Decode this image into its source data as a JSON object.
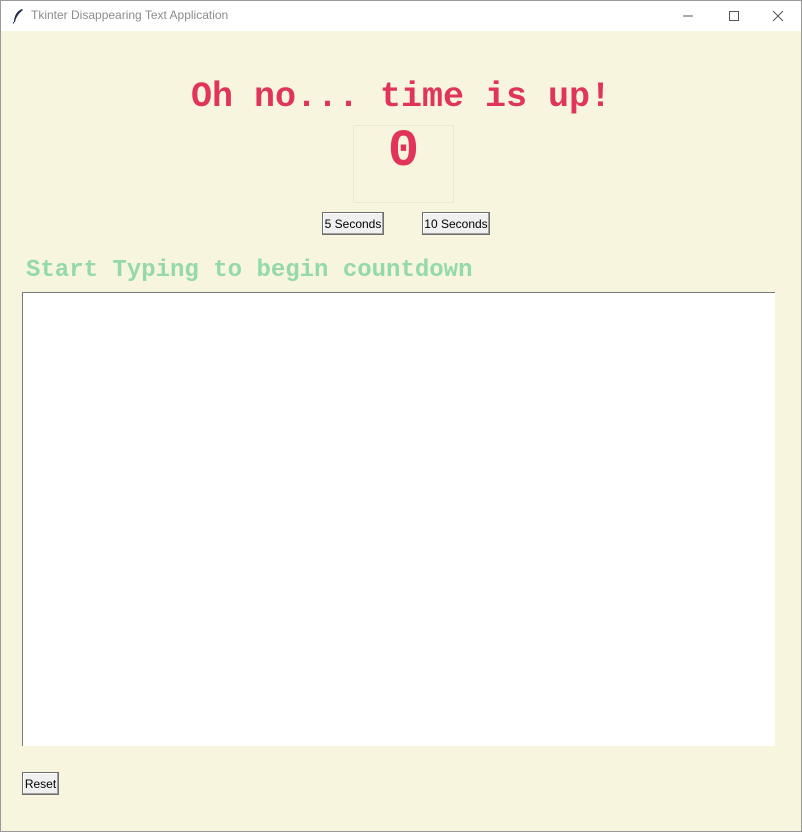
{
  "window": {
    "title": "Tkinter Disappearing Text Application",
    "icons": [
      "feather-icon",
      "minimize-icon",
      "maximize-icon",
      "close-icon"
    ]
  },
  "main": {
    "heading": "Oh no... time is up!",
    "timer_value": "0",
    "duration_buttons": {
      "five": "5 Seconds",
      "ten": "10 Seconds"
    },
    "instruction": "Start Typing to begin countdown",
    "text_area_value": "",
    "reset_label": "Reset"
  },
  "colors": {
    "background": "#f7f5de",
    "heading": "#e0345a",
    "timer": "#e0345a",
    "instruction": "#94d9a8",
    "text_area": "#ffffff"
  }
}
